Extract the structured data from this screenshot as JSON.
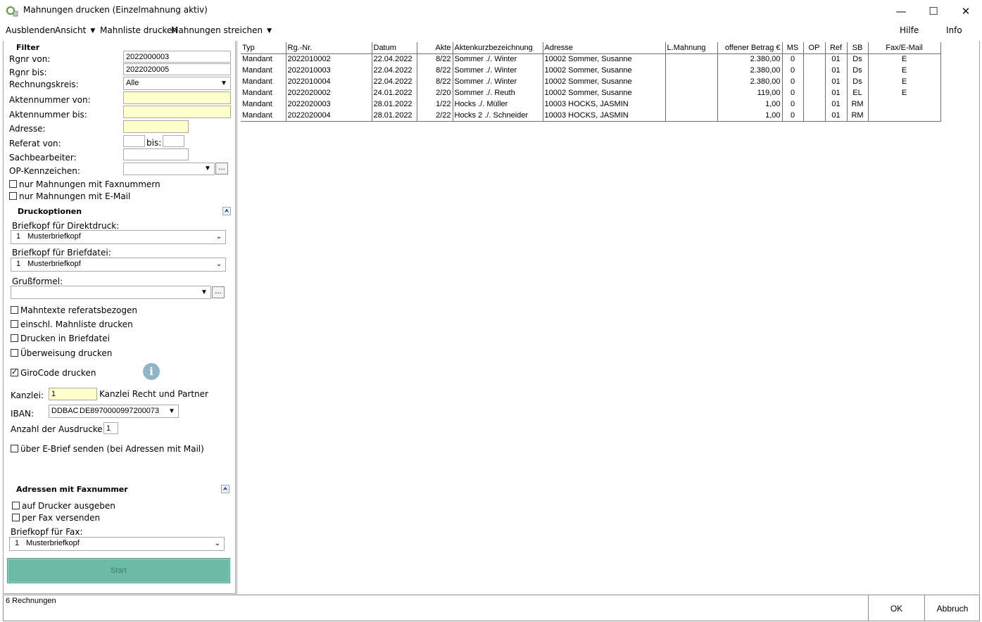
{
  "window": {
    "title": "Mahnungen drucken (Einzelmahnung aktiv)",
    "minimize": "—",
    "maximize": "☐",
    "close": "✕"
  },
  "menu": {
    "ausblenden": "Ausblenden",
    "ansicht": "Ansicht",
    "mahnliste": "Mahnliste drucken",
    "streichen": "Mahnungen streichen",
    "hilfe": "Hilfe",
    "info": "Info"
  },
  "filter": {
    "title": "Filter",
    "rgnr_von_label": "Rgnr von:",
    "rgnr_von": "2022000003",
    "rgnr_bis_label": "Rgnr bis:",
    "rgnr_bis": "2022020005",
    "rechnungskreis_label": "Rechnungskreis:",
    "rechnungskreis": "Alle",
    "aktennummer_von_label": "Aktennummer von:",
    "aktennummer_von": "",
    "aktennummer_bis_label": "Aktennummer bis:",
    "aktennummer_bis": "",
    "adresse_label": "Adresse:",
    "adresse": "",
    "referat_von_label": "Referat von:",
    "referat_von": "",
    "bis_label": "bis:",
    "referat_bis": "",
    "sachbearbeiter_label": "Sachbearbeiter:",
    "sachbearbeiter": "",
    "op_label": "OP-Kennzeichen:",
    "op_value": "",
    "nur_fax": "nur Mahnungen mit Faxnummern",
    "nur_mail": "nur Mahnungen mit E-Mail"
  },
  "druck": {
    "title": "Druckoptionen",
    "briefkopf_direkt_label": "Briefkopf für Direktdruck:",
    "briefkopf_direkt_nr": "1",
    "briefkopf_direkt": "Musterbriefkopf",
    "briefkopf_datei_label": "Briefkopf für Briefdatei:",
    "briefkopf_datei_nr": "1",
    "briefkopf_datei": "Musterbriefkopf",
    "gruss_label": "Grußformel:",
    "gruss": "",
    "mahntexte": "Mahntexte referatsbezogen",
    "einschl": "einschl. Mahnliste drucken",
    "briefdatei": "Drucken in Briefdatei",
    "ueberweisung": "Überweisung drucken",
    "girocode": "GiroCode drucken",
    "info_glyph": "i",
    "kanzlei_label": "Kanzlei:",
    "kanzlei_nr": "1",
    "kanzlei_name": "Kanzlei Recht und Partner",
    "iban_label": "IBAN:",
    "iban_bank": "DDBAC",
    "iban": "DE8970000997200073",
    "anzahl_label": "Anzahl der Ausdrucke:",
    "anzahl": "1",
    "ebrief": "über E-Brief senden (bei Adressen mit Mail)"
  },
  "fax": {
    "title": "Adressen mit Faxnummer",
    "drucker": "auf Drucker ausgeben",
    "per_fax": "per Fax versenden",
    "briefkopf_label": "Briefkopf für Fax:",
    "briefkopf_nr": "1",
    "briefkopf": "Musterbriefkopf"
  },
  "start": "Start",
  "grid": {
    "headers": [
      "Typ",
      "Rg.-Nr.",
      "Datum",
      "Akte",
      "Aktenkurzbezeichnung",
      "Adresse",
      "L.Mahnung",
      "offener Betrag €",
      "MS",
      "OP",
      "Ref",
      "SB",
      "Fax/E-Mail"
    ],
    "rows": [
      [
        "Mandant",
        "2022010002",
        "22.04.2022",
        "8/22",
        "Sommer ./. Winter",
        "10002 Sommer, Susanne",
        "",
        "2.380,00",
        "0",
        "",
        "01",
        "Ds",
        "E"
      ],
      [
        "Mandant",
        "2022010003",
        "22.04.2022",
        "8/22",
        "Sommer ./. Winter",
        "10002 Sommer, Susanne",
        "",
        "2.380,00",
        "0",
        "",
        "01",
        "Ds",
        "E"
      ],
      [
        "Mandant",
        "2022010004",
        "22.04.2022",
        "8/22",
        "Sommer ./. Winter",
        "10002 Sommer, Susanne",
        "",
        "2.380,00",
        "0",
        "",
        "01",
        "Ds",
        "E"
      ],
      [
        "Mandant",
        "2022020002",
        "24.01.2022",
        "2/20",
        "Sommer ./. Reuth",
        "10002 Sommer, Susanne",
        "",
        "119,00",
        "0",
        "",
        "01",
        "EL",
        "E"
      ],
      [
        "Mandant",
        "2022020003",
        "28.01.2022",
        "1/22",
        "Hocks ./. Müller",
        "10003 HOCKS, JASMIN",
        "",
        "1,00",
        "0",
        "",
        "01",
        "RM",
        ""
      ],
      [
        "Mandant",
        "2022020004",
        "28.01.2022",
        "2/22",
        "Hocks 2 ./. Schneider",
        "10003 HOCKS, JASMIN",
        "",
        "1,00",
        "0",
        "",
        "01",
        "RM",
        ""
      ]
    ]
  },
  "status": {
    "count": "6 Rechnungen",
    "ok": "OK",
    "abbruch": "Abbruch"
  }
}
